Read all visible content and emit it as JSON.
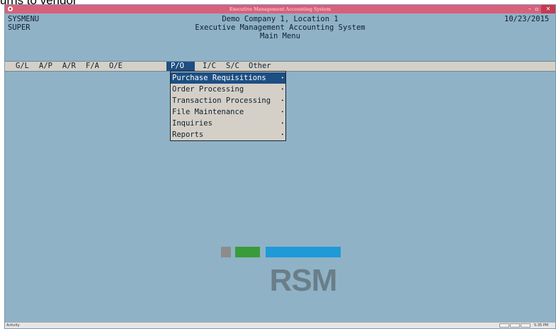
{
  "doc": {
    "caption": "urns to vendor"
  },
  "window": {
    "title": "Executive Management Accounting System"
  },
  "header": {
    "left1": "SYSMENU",
    "left2": "SUPER",
    "center1": "Demo Company 1, Location 1",
    "center2": "Executive Management Accounting System",
    "center3": "Main Menu",
    "date": "10/23/2015"
  },
  "menubar": {
    "items": [
      {
        "label": "G/L"
      },
      {
        "label": "A/P"
      },
      {
        "label": "A/R"
      },
      {
        "label": "F/A"
      },
      {
        "label": "O/E"
      },
      {
        "label": "P/O"
      },
      {
        "label": "I/C"
      },
      {
        "label": "S/C"
      },
      {
        "label": "Other"
      }
    ],
    "active": "P/O"
  },
  "dropdown": {
    "items": [
      {
        "label": "Purchase Requisitions"
      },
      {
        "label": "Order Processing"
      },
      {
        "label": "Transaction Processing"
      },
      {
        "label": "File Maintenance"
      },
      {
        "label": "Inquiries"
      },
      {
        "label": "Reports"
      }
    ],
    "highlighted": "Purchase Requisitions",
    "submenu_icon": "triangle-right-icon"
  },
  "logo": {
    "text": "RSM",
    "colors": [
      "#8c8c8c",
      "#3a9b3a",
      "#1f9ad8"
    ]
  },
  "statusbar": {
    "left": "Activity",
    "right": "5:35 PM"
  },
  "colors": {
    "background": "#8fb2c7",
    "titlebar": "#d8607a",
    "menu_highlight": "#1d4f83",
    "menubar": "#d4d0c8"
  }
}
